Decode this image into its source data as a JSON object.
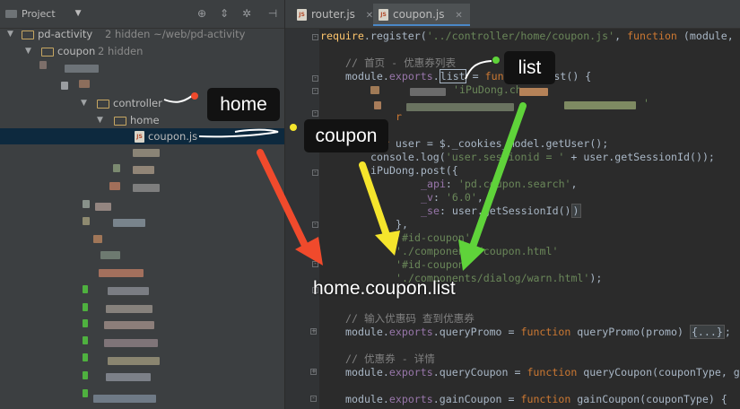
{
  "project_pane": {
    "header": {
      "title": "Project",
      "dropdown_icon": "chevron-down-icon",
      "icons": [
        "locate-icon",
        "collapse-icon",
        "gear-icon",
        "hide-icon"
      ]
    },
    "tree": [
      {
        "label": "pd-activity",
        "muted": "2 hidden  ~/web/pd-activity",
        "expanded": true
      },
      {
        "label": "coupon",
        "muted": "2 hidden",
        "expanded": true
      },
      {
        "label": "controller",
        "expanded": true
      },
      {
        "label": "home",
        "expanded": true
      },
      {
        "label": "coupon.js",
        "file": true,
        "selected": true
      }
    ]
  },
  "editor": {
    "tabs": [
      {
        "label": "router.js",
        "close": "✕",
        "active": false
      },
      {
        "label": "coupon.js",
        "close": "✕",
        "active": true
      }
    ],
    "code": {
      "l1_kw": "require",
      "l1_a": ".register(",
      "l1_str": "'../controller/home/coupon.js'",
      "l1_b": ", ",
      "l1_fn": "function",
      "l1_c": " (module,",
      "comment_home": "// 首页 - 优惠券列表",
      "exports_a": "module.",
      "exports_b": "exports",
      "exports_c": ".",
      "exports_list": "list",
      "exports_d": " = ",
      "exports_fn": "function",
      "exports_e": " list() {",
      "s_inner": "'iPuDong.ch",
      "s_inner2": "'",
      "l_r": "r",
      "var_user_kw": "var",
      "var_user": " user = $._cookies_model.getUser();",
      "console_a": "console.log(",
      "console_str": "'user.sessionid = '",
      "console_b": " + user.getSessionId());",
      "post": "iPuDong.post({",
      "api_key": "_api",
      "api_sep": ": ",
      "api_val": "'pd.coupon.search'",
      "api_end": ",",
      "v_key": "_v",
      "v_sep": ": ",
      "v_val": "'6.0'",
      "v_end": ",",
      "se_key": "_se",
      "se_rest": ": user.getSessionId()",
      "se_close": ")",
      "close_obj": "},",
      "id1": "'#id-coupon'",
      "comp1": "'./components/coupon.html'",
      "id2": "'#id-coupon'",
      "comp2": "'./components/dialog/warn.html'",
      "comp2_end": ");",
      "comment_promo": "// 输入优惠码 查到优惠券",
      "qp_a": "module.",
      "qp_b": "exports",
      "qp_c": ".queryPromo = ",
      "qp_fn": "function",
      "qp_d": " queryPromo(promo) ",
      "qp_fold": "{...}",
      "qp_e": ";",
      "comment_detail": "// 优惠券 - 详情",
      "qc_a": "module.",
      "qc_b": "exports",
      "qc_c": ".queryCoupon = ",
      "qc_fn": "function",
      "qc_d": " queryCoupon(couponType, g",
      "gc_a": "module.",
      "gc_b": "exports",
      "gc_c": ".gainCoupon = ",
      "gc_fn": "function",
      "gc_d": " gainCoupon(couponType) {"
    }
  },
  "annotations": {
    "home": "home",
    "coupon": "coupon",
    "list": "list",
    "result": "home.coupon.list"
  },
  "colors": {
    "arrow_red": "#f04a2c",
    "arrow_yellow": "#f5e52c",
    "arrow_green": "#5fd33a",
    "string": "#6a8759",
    "keyword": "#cc7832"
  }
}
